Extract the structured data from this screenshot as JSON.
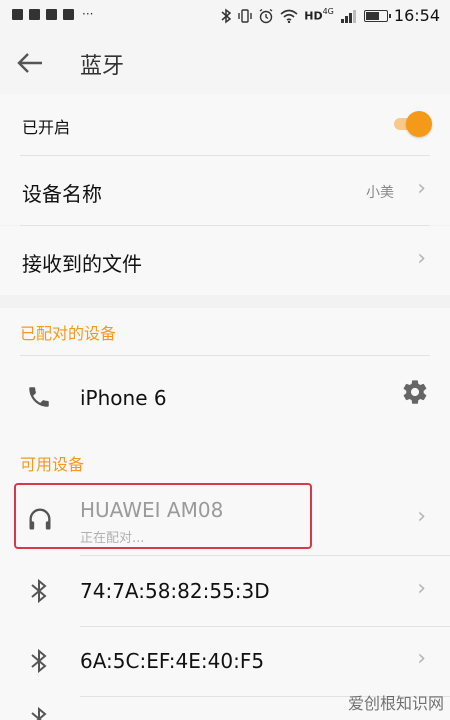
{
  "status_bar": {
    "notif_more": "···",
    "network": "HD",
    "network_gen": "4G",
    "battery_level": 0.7,
    "time": "16:54"
  },
  "header": {
    "title": "蓝牙"
  },
  "toggle_row": {
    "label": "已开启",
    "on": true
  },
  "settings": [
    {
      "label": "设备名称",
      "value": "小美"
    },
    {
      "label": "接收到的文件",
      "value": ""
    }
  ],
  "paired": {
    "title": "已配对的设备",
    "devices": [
      {
        "name": "iPhone 6",
        "icon": "phone-icon"
      }
    ]
  },
  "available": {
    "title": "可用设备",
    "devices": [
      {
        "name": "HUAWEI AM08",
        "status": "正在配对...",
        "icon": "headphones-icon"
      },
      {
        "name": "74:7A:58:82:55:3D",
        "icon": "bluetooth-icon"
      },
      {
        "name": "6A:5C:EF:4E:40:F5",
        "icon": "bluetooth-icon"
      }
    ]
  },
  "watermark": "爱创根知识网",
  "colors": {
    "accent": "#f59a18",
    "highlight_border": "#d9374a"
  }
}
